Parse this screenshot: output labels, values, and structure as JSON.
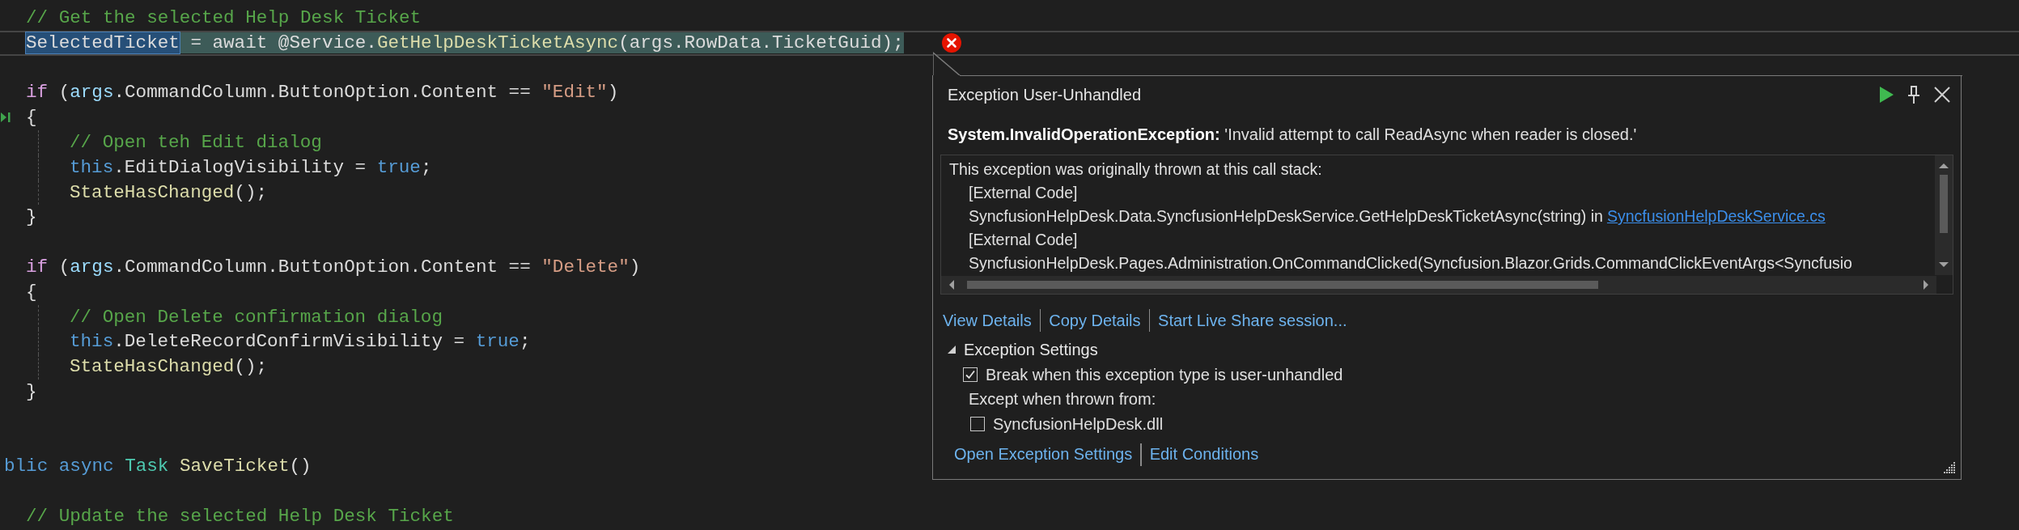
{
  "editor": {
    "lines": [
      {
        "kind": "member",
        "tokens": [
          {
            "text": "// Get the selected Help Desk Ticket",
            "kind": "comment"
          }
        ]
      },
      {
        "kind": "member",
        "next_statement": true,
        "tokens": [
          {
            "text": "SelectedTicket",
            "kind": "plain",
            "selected": true
          },
          {
            "text": " = await @Service.",
            "kind": "plain"
          },
          {
            "text": "GetHelpDeskTicketAsync",
            "kind": "method"
          },
          {
            "text": "(args.RowData.TicketGuid);",
            "kind": "plain"
          }
        ]
      },
      {
        "kind": "blank"
      },
      {
        "kind": "member",
        "tokens": [
          {
            "text": "if",
            "kind": "control"
          },
          {
            "text": " (",
            "kind": "plain"
          },
          {
            "text": "args",
            "kind": "variable"
          },
          {
            "text": ".CommandColumn.ButtonOption.Content == ",
            "kind": "plain"
          },
          {
            "text": "\"Edit\"",
            "kind": "string"
          },
          {
            "text": ")",
            "kind": "plain"
          }
        ]
      },
      {
        "kind": "member",
        "gutter_marker": true,
        "tokens": [
          {
            "text": "{",
            "kind": "plain"
          }
        ]
      },
      {
        "kind": "body",
        "tokens": [
          {
            "text": "// Open teh Edit dialog",
            "kind": "comment"
          }
        ]
      },
      {
        "kind": "body",
        "tokens": [
          {
            "text": "this",
            "kind": "keyword"
          },
          {
            "text": ".EditDialogVisibility = ",
            "kind": "plain"
          },
          {
            "text": "true",
            "kind": "keyword"
          },
          {
            "text": ";",
            "kind": "plain"
          }
        ]
      },
      {
        "kind": "body",
        "tokens": [
          {
            "text": "StateHasChanged",
            "kind": "method"
          },
          {
            "text": "();",
            "kind": "plain"
          }
        ]
      },
      {
        "kind": "member",
        "tokens": [
          {
            "text": "}",
            "kind": "plain"
          }
        ]
      },
      {
        "kind": "blank"
      },
      {
        "kind": "member",
        "tokens": [
          {
            "text": "if",
            "kind": "control"
          },
          {
            "text": " (",
            "kind": "plain"
          },
          {
            "text": "args",
            "kind": "variable"
          },
          {
            "text": ".CommandColumn.ButtonOption.Content == ",
            "kind": "plain"
          },
          {
            "text": "\"Delete\"",
            "kind": "string"
          },
          {
            "text": ")",
            "kind": "plain"
          }
        ]
      },
      {
        "kind": "member",
        "tokens": [
          {
            "text": "{",
            "kind": "plain"
          }
        ]
      },
      {
        "kind": "body",
        "tokens": [
          {
            "text": "// Open Delete confirmation dialog",
            "kind": "comment"
          }
        ]
      },
      {
        "kind": "body",
        "tokens": [
          {
            "text": "this",
            "kind": "keyword"
          },
          {
            "text": ".DeleteRecordConfirmVisibility = ",
            "kind": "plain"
          },
          {
            "text": "true",
            "kind": "keyword"
          },
          {
            "text": ";",
            "kind": "plain"
          }
        ]
      },
      {
        "kind": "body",
        "tokens": [
          {
            "text": "StateHasChanged",
            "kind": "method"
          },
          {
            "text": "();",
            "kind": "plain"
          }
        ]
      },
      {
        "kind": "member",
        "tokens": [
          {
            "text": "}",
            "kind": "plain"
          }
        ]
      },
      {
        "kind": "blank"
      },
      {
        "kind": "blank"
      },
      {
        "kind": "cut",
        "tokens": [
          {
            "text": "blic async ",
            "kind": "keyword"
          },
          {
            "text": "Task ",
            "kind": "type"
          },
          {
            "text": "SaveTicket",
            "kind": "method"
          },
          {
            "text": "()",
            "kind": "plain"
          }
        ]
      },
      {
        "kind": "blank"
      },
      {
        "kind": "member",
        "tokens": [
          {
            "text": "// Update the selected Help Desk Ticket",
            "kind": "comment"
          }
        ]
      }
    ]
  },
  "exception_popup": {
    "title": "Exception User-Unhandled",
    "exception_type": "System.InvalidOperationException:",
    "message": "'Invalid attempt to call ReadAsync when reader is closed.'",
    "call_stack": {
      "heading": "This exception was originally thrown at this call stack:",
      "frames": [
        {
          "text": "[External Code]"
        },
        {
          "text": "SyncfusionHelpDesk.Data.SyncfusionHelpDeskService.GetHelpDeskTicketAsync(string) in",
          "link": "SyncfusionHelpDeskService.cs"
        },
        {
          "text": "[External Code]"
        },
        {
          "text": "SyncfusionHelpDesk.Pages.Administration.OnCommandClicked(Syncfusion.Blazor.Grids.CommandClickEventArgs<Syncfusio"
        }
      ]
    },
    "links": [
      "View Details",
      "Copy Details",
      "Start Live Share session..."
    ],
    "settings": {
      "title": "Exception Settings",
      "expanded": true,
      "break_option": {
        "label": "Break when this exception type is user-unhandled",
        "checked": true
      },
      "except_label": "Except when thrown from:",
      "modules": [
        {
          "label": "SyncfusionHelpDesk.dll",
          "checked": false
        }
      ]
    },
    "footer_links": [
      "Open Exception Settings",
      "Edit Conditions"
    ]
  }
}
